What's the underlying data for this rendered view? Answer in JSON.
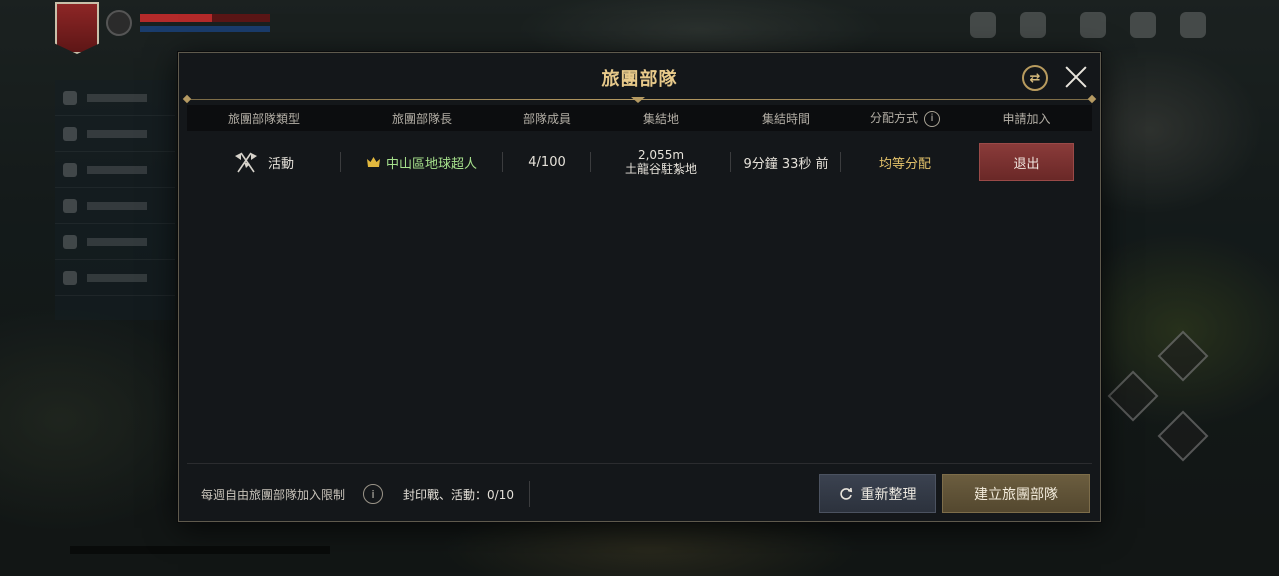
{
  "dialog": {
    "title": "旅團部隊",
    "swap_icon": "swap-arrows-icon",
    "close_icon": "close-icon"
  },
  "table": {
    "headers": [
      "旅團部隊類型",
      "旅團部隊長",
      "部隊成員",
      "集結地",
      "集結時間",
      "分配方式",
      "申請加入"
    ],
    "rows": [
      {
        "type_icon": "crossed-flags-icon",
        "type": "活動",
        "leader_icon": "crown-icon",
        "leader": "中山區地球超人",
        "members": "4/100",
        "distance": "2,055m",
        "location": "土龍谷駐紮地",
        "time": "9分鐘 33秒 前",
        "distribution": "均等分配",
        "action": "退出"
      }
    ]
  },
  "footer": {
    "weekly_limit_label": "每週自由旅團部隊加入限制",
    "weekly_count": "封印戰、活動：0/10",
    "refresh_label": "重新整理",
    "create_label": "建立旅團部隊"
  },
  "colors": {
    "title": "#e7c98a",
    "leader": "#a6e08c",
    "distribution": "#e2c16a",
    "leave_button": "#7a3130",
    "create_button": "#5e5136",
    "refresh_button": "#333a46"
  }
}
